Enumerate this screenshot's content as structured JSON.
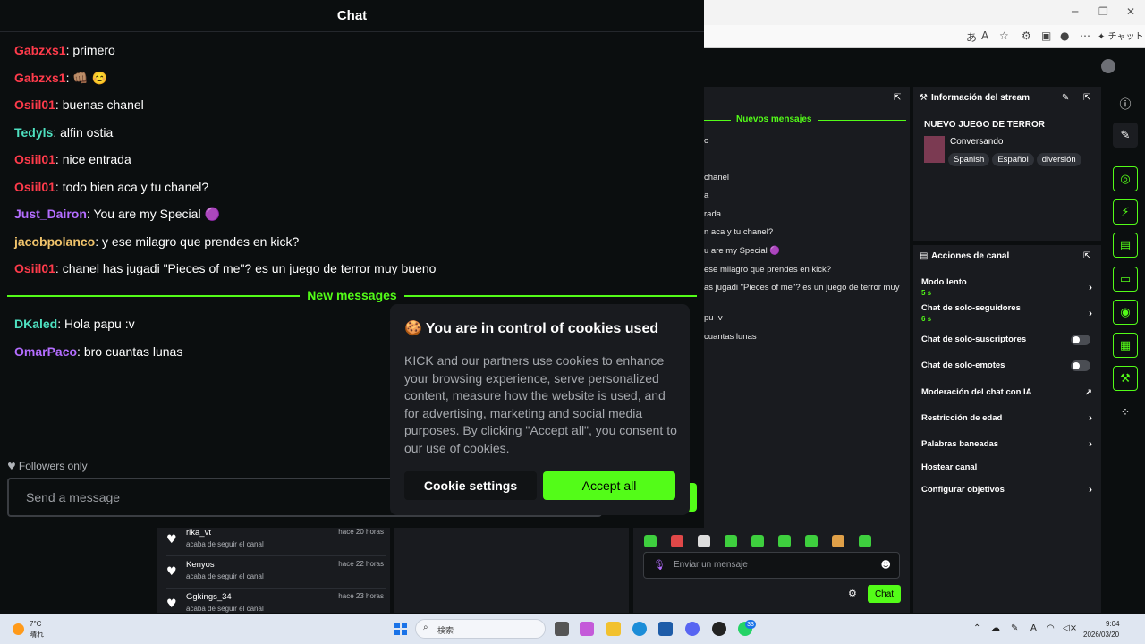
{
  "browser": {
    "copilot_label": "チャット",
    "icons": [
      "translate-icon",
      "read-aloud-icon",
      "favorite-icon",
      "extensions-icon",
      "split-screen-icon",
      "profile-icon",
      "more-icon",
      "copilot-icon"
    ]
  },
  "chat_popout": {
    "title": "Chat",
    "messages": [
      {
        "user": "Gabzxs1",
        "text": ": primero",
        "color": "#ff3b4b"
      },
      {
        "user": "Gabzxs1",
        "text": ": 👊🏽 😊",
        "color": "#ff3b4b"
      },
      {
        "user": "Osiil01",
        "text": ": buenas chanel",
        "color": "#ff3b4b"
      },
      {
        "user": "Tedyls",
        "text": ": alfin ostia",
        "color": "#4ee0c0"
      },
      {
        "user": "Osiil01",
        "text": ": nice entrada",
        "color": "#ff3b4b"
      },
      {
        "user": "Osiil01",
        "text": ": todo bien aca y tu chanel?",
        "color": "#ff3b4b"
      },
      {
        "user": "Just_Dairon",
        "text": ": You are my Special 🟣",
        "color": "#b46dff"
      },
      {
        "user": "jacobpolanco",
        "text": ": y ese milagro que prendes en kick?",
        "color": "#f0c36b"
      },
      {
        "user": "Osiil01",
        "text": ": chanel has jugadi \"Pieces of me\"? es un juego de terror muy bueno",
        "color": "#ff3b4b"
      }
    ],
    "new_messages_label": "New messages",
    "new_messages": [
      {
        "user": "DKaled",
        "text": ": Hola papu :v",
        "color": "#4ee0c0"
      },
      {
        "user": "OmarPaco",
        "text": ": bro cuantas lunas",
        "color": "#b46dff"
      }
    ],
    "followers_only": "Followers only",
    "input_placeholder": "Send a message"
  },
  "cookie_dialog": {
    "title": "You are in control of cookies used",
    "body": "KICK and our partners use cookies to enhance your browsing experience, serve personalized content, measure how the website is used, and for advertising, marketing and social media purposes. By clicking \"Accept all\", you consent to our use of cookies.",
    "settings_label": "Cookie settings",
    "accept_label": "Accept all"
  },
  "dashboard": {
    "bg_chat": {
      "new_messages_label": "Nuevos mensajes",
      "lines": [
        "o",
        "chanel",
        "a",
        "rada",
        "n aca y tu chanel?",
        "u are my Special 🟣",
        "ese milagro que prendes en kick?",
        "as jugadi \"Pieces of me\"? es un juego de terror muy",
        "pu :v",
        "cuantas lunas"
      ]
    },
    "stream_info": {
      "panel_title": "Información del stream",
      "stream_title": "NUEVO JUEGO DE TERROR",
      "category": "Conversando",
      "tags": [
        "Spanish",
        "Español",
        "diversión"
      ]
    },
    "actions": {
      "panel_title": "Acciones de canal",
      "items": [
        {
          "label": "Modo lento",
          "sub": "5 s",
          "control": "chevron"
        },
        {
          "label": "Chat de solo-seguidores",
          "sub": "6 s",
          "control": "chevron"
        },
        {
          "label": "Chat de solo-suscriptores",
          "sub": "",
          "control": "toggle"
        },
        {
          "label": "Chat de solo-emotes",
          "sub": "",
          "control": "toggle"
        },
        {
          "label": "Moderación del chat con IA",
          "sub": "",
          "control": "external"
        },
        {
          "label": "Restricción de edad",
          "sub": "",
          "control": "chevron"
        },
        {
          "label": "Palabras baneadas",
          "sub": "",
          "control": "chevron"
        },
        {
          "label": "Hostear canal",
          "sub": "",
          "control": "none"
        },
        {
          "label": "Configurar objetivos",
          "sub": "",
          "control": "chevron"
        }
      ]
    },
    "followers": [
      {
        "name": "rika_vt",
        "sub": "acaba de seguir el canal",
        "time": "hace 20 horas"
      },
      {
        "name": "Kenyos",
        "sub": "acaba de seguir el canal",
        "time": "hace 22 horas"
      },
      {
        "name": "Ggkings_34",
        "sub": "acaba de seguir el canal",
        "time": "hace 23 horas"
      }
    ],
    "chat_input_placeholder": "Enviar un mensaje",
    "chat_button": "Chat",
    "accent": "#53fc18"
  },
  "taskbar": {
    "weather_temp": "7°C",
    "weather_cond": "晴れ",
    "search_placeholder": "検索",
    "badge_count": "33",
    "clock_time": "9:04",
    "clock_date": "2026/03/20"
  }
}
